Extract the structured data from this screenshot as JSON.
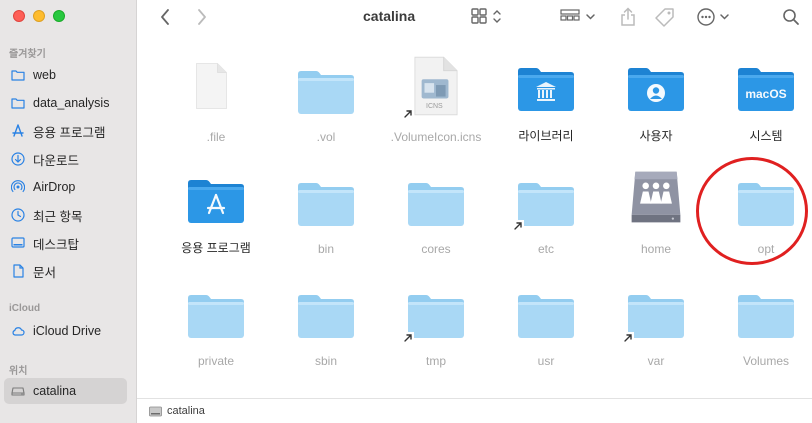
{
  "window": {
    "title": "catalina"
  },
  "sidebar": {
    "favorites_label": "즐겨찾기",
    "favorites": [
      {
        "label": "web",
        "icon": "folder-icon"
      },
      {
        "label": "data_analysis",
        "icon": "folder-icon"
      },
      {
        "label": "응용 프로그램",
        "icon": "applications-icon"
      },
      {
        "label": "다운로드",
        "icon": "download-icon"
      },
      {
        "label": "AirDrop",
        "icon": "airdrop-icon"
      },
      {
        "label": "최근 항목",
        "icon": "clock-icon"
      },
      {
        "label": "데스크탑",
        "icon": "desktop-icon"
      },
      {
        "label": "문서",
        "icon": "document-icon"
      }
    ],
    "icloud_label": "iCloud",
    "icloud": [
      {
        "label": "iCloud Drive",
        "icon": "cloud-icon"
      }
    ],
    "locations_label": "위치",
    "locations": [
      {
        "label": "catalina",
        "icon": "drive-icon",
        "active": true
      }
    ]
  },
  "files": [
    {
      "label": ".file",
      "kind": "document",
      "dim": true
    },
    {
      "label": ".vol",
      "kind": "folder",
      "dim": true
    },
    {
      "label": ".VolumeIcon.icns",
      "kind": "icns",
      "dim": true,
      "alias": true,
      "badge": "ICNS"
    },
    {
      "label": "라이브러리",
      "kind": "library-folder"
    },
    {
      "label": "사용자",
      "kind": "users-folder"
    },
    {
      "label": "시스템",
      "kind": "system-folder",
      "badge": "macOS"
    },
    {
      "label": "응용 프로그램",
      "kind": "apps-folder"
    },
    {
      "label": "bin",
      "kind": "folder",
      "dim": true
    },
    {
      "label": "cores",
      "kind": "folder",
      "dim": true
    },
    {
      "label": "etc",
      "kind": "folder",
      "dim": true,
      "alias": true
    },
    {
      "label": "home",
      "kind": "home-drive",
      "dim": true
    },
    {
      "label": "opt",
      "kind": "folder",
      "dim": true
    },
    {
      "label": "private",
      "kind": "folder",
      "dim": true
    },
    {
      "label": "sbin",
      "kind": "folder",
      "dim": true
    },
    {
      "label": "tmp",
      "kind": "folder",
      "dim": true,
      "alias": true
    },
    {
      "label": "usr",
      "kind": "folder",
      "dim": true
    },
    {
      "label": "var",
      "kind": "folder",
      "dim": true,
      "alias": true
    },
    {
      "label": "Volumes",
      "kind": "folder",
      "dim": true
    }
  ],
  "pathbar": {
    "label": "catalina"
  },
  "colors": {
    "folder_light": "#a9d8f5",
    "folder_dark": "#2c97e6",
    "annotation": "#e02020"
  }
}
